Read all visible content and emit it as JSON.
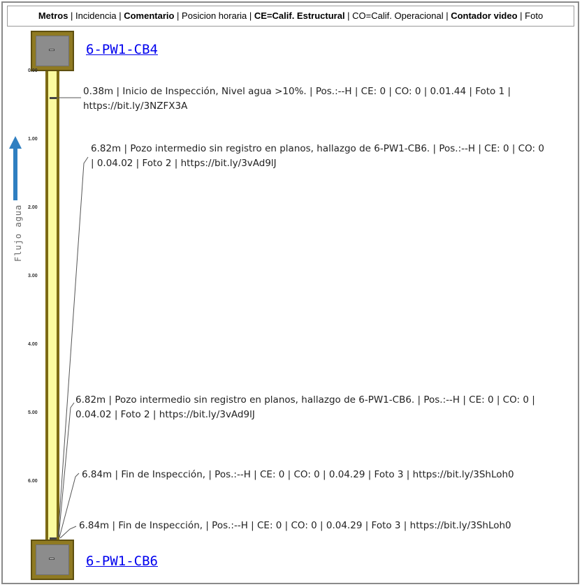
{
  "legend": {
    "metros": "Metros",
    "sep1": " | ",
    "incidencia": "Incidencia",
    "sep2": " | ",
    "comentario": "Comentario",
    "sep3": " | ",
    "posicion": "Posicion horaria",
    "sep4": " | ",
    "ce": "CE=Calif. Estructural",
    "sep5": " | ",
    "co": "CO=Calif. Operacional",
    "sep6": " | ",
    "contador": "Contador video",
    "sep7": " | ",
    "foto": "Foto"
  },
  "manholes": {
    "top": "6-PW1-CB4",
    "bottom": "6-PW1-CB6"
  },
  "flow_label": "Flujo agua",
  "axis": {
    "ticks": [
      "0.00",
      "1.00",
      "2.00",
      "3.00",
      "4.00",
      "5.00",
      "6.00"
    ]
  },
  "observations": [
    {
      "line1": "0.38m | Inicio de Inspección, Nivel agua >10%. | Pos.:--H | CE: 0 | CO: 0 | 0.01.44 | Foto 1 |",
      "line2": "https://bit.ly/3NZFX3A"
    },
    {
      "line1": "6.82m | Pozo intermedio sin registro en planos, hallazgo de 6-PW1-CB6. | Pos.:--H | CE: 0 | CO: 0",
      "line2": "| 0.04.02 | Foto 2 | https://bit.ly/3vAd9lJ"
    },
    {
      "line1": "6.82m | Pozo intermedio sin registro en planos, hallazgo de 6-PW1-CB6. | Pos.:--H | CE: 0 | CO: 0 |",
      "line2": "0.04.02 | Foto 2 | https://bit.ly/3vAd9lJ"
    },
    {
      "line1": "6.84m | Fin de Inspección, | Pos.:--H | CE: 0 | CO: 0 | 0.04.29 | Foto 3 | https://bit.ly/3ShLoh0"
    },
    {
      "line1": "6.84m | Fin de Inspección, | Pos.:--H | CE: 0 | CO: 0 | 0.04.29 | Foto 3 | https://bit.ly/3ShLoh0"
    }
  ],
  "colors": {
    "pipe_fill": "#fbfba0",
    "pipe_wall": "#7d6b14",
    "manhole": "#8f7a22",
    "link": "#0000ee",
    "arrow": "#2f7fc1"
  }
}
